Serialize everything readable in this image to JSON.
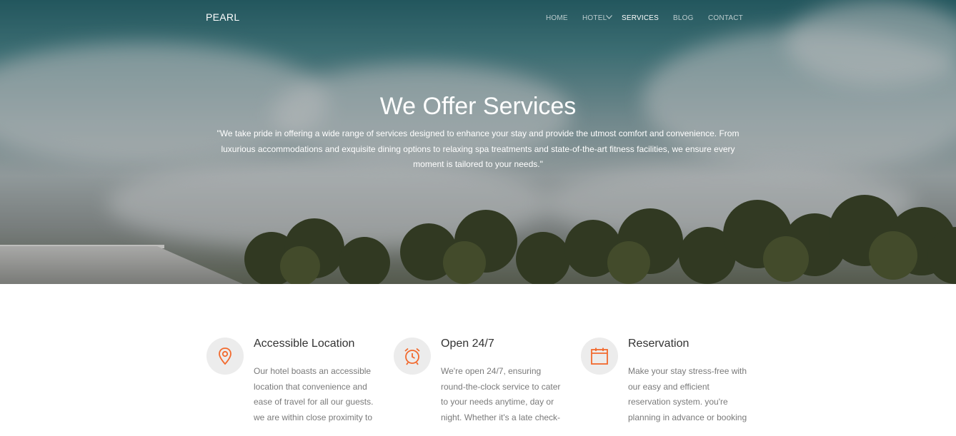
{
  "brand": {
    "logo": "PEARL"
  },
  "nav": {
    "items": [
      {
        "label": "HOME",
        "active": false
      },
      {
        "label": "HOTEL",
        "active": false,
        "dropdown": true
      },
      {
        "label": "SERVICES",
        "active": true
      },
      {
        "label": "BLOG",
        "active": false
      },
      {
        "label": "CONTACT",
        "active": false
      }
    ]
  },
  "hero": {
    "title": "We Offer Services",
    "text": "\"We take pride in offering a wide range of services designed to enhance your stay and provide the utmost comfort and convenience. From luxurious accommodations and exquisite dining options to relaxing spa treatments and state-of-the-art fitness facilities, we ensure every moment is tailored to your needs.\""
  },
  "services": [
    {
      "icon": "map-pin-icon",
      "title": "Accessible Location",
      "text": "Our hotel boasts an accessible location that convenience and ease of travel for all our guests. we are within close proximity to"
    },
    {
      "icon": "alarm-clock-icon",
      "title": "Open 24/7",
      "text": "We're open 24/7, ensuring round-the-clock service to cater to your needs anytime, day or night. Whether it's a late check-"
    },
    {
      "icon": "calendar-icon",
      "title": "Reservation",
      "text": "Make your stay stress-free with our easy and efficient reservation system. you're planning in advance or booking"
    }
  ],
  "colors": {
    "accent": "#f26a2e",
    "icon_bg": "#ececec",
    "heading": "#333333",
    "body_text": "#7a7a7a"
  }
}
